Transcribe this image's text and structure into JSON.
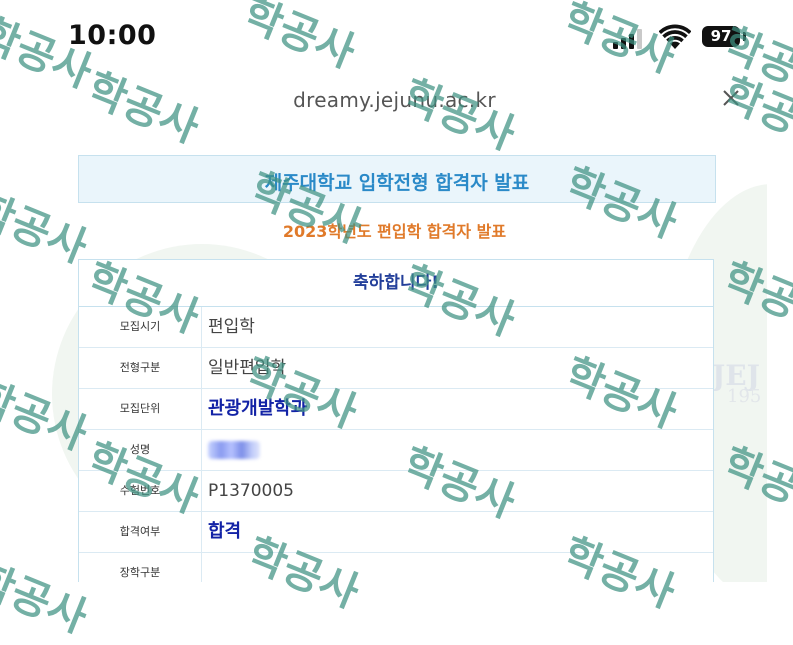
{
  "status_bar": {
    "time": "10:00",
    "battery": "97",
    "icons": [
      "signal-icon",
      "wifi-icon",
      "battery-icon"
    ]
  },
  "browser": {
    "url": "dreamy.jejunu.ac.kr",
    "close_icon": "close-icon"
  },
  "page": {
    "title": "제주대학교 입학전형 합격자 발표",
    "subtitle": "2023학년도 편입학 합격자 발표",
    "congrats": "축하합니다!",
    "rows": [
      {
        "label": "모집시기",
        "value": "편입학",
        "style": "normal"
      },
      {
        "label": "전형구분",
        "value": "일반편입학",
        "style": "normal"
      },
      {
        "label": "모집단위",
        "value": "관광개발학과",
        "style": "strong"
      },
      {
        "label": "성명",
        "value": "",
        "style": "blurred"
      },
      {
        "label": "수험번호",
        "value": "P1370005",
        "style": "normal"
      },
      {
        "label": "합격여부",
        "value": "합격",
        "style": "strong"
      },
      {
        "label": "장학구분",
        "value": "",
        "style": "normal"
      }
    ],
    "seal": {
      "text": "JEJ",
      "year": "195"
    }
  },
  "watermark": {
    "text": "학공사"
  },
  "colors": {
    "title_blue": "#2b8ac8",
    "subtitle_orange": "#e07a2a",
    "strong_value": "#1323a6",
    "watermark": "#3e9182"
  }
}
